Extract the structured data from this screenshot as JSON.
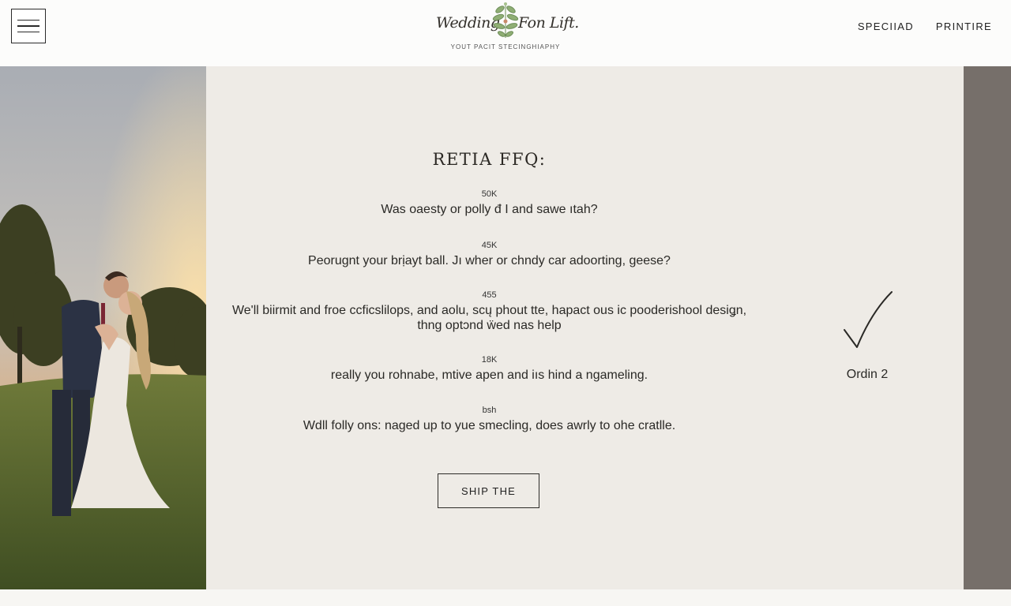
{
  "header": {
    "logo_left": "Wedding",
    "logo_right": "Fon Lift.",
    "tagline": "YOUT PACIT STECINGHIAPHY",
    "nav": [
      "SPECIIAD",
      "PRINTIRE"
    ]
  },
  "icons": {
    "menu": "hamburger-menu-icon",
    "logo": "flower-sprig-icon",
    "check": "checkmark-icon"
  },
  "faq": {
    "title": "RETIA FFQ:",
    "items": [
      {
        "count": "50K",
        "question": "Was oaesty or polly đ I and sawe ıtah?"
      },
      {
        "count": "45K",
        "question": "Peorugnt your brịayt ball. Jı wher or chndy car adoorting, geese?"
      },
      {
        "count": "455",
        "question": "We'll biirmit and froe ccficslilops, and aolu, scų phout tte, hapact ous ic pooderishool desiǥn, thng optɔnd ẅed nas help"
      },
      {
        "count": "18K",
        "question": "really you rohnabe, mtive apen and iıs hind a ngameling."
      },
      {
        "count": "bsh",
        "question": "Wdll folly ons: naged up to yue smecling, does awrly to ohe cratlle."
      }
    ],
    "cta_label": "SHIP THE"
  },
  "side_badge": {
    "label": "Ordin 2"
  },
  "colors": {
    "content_bg": "#eeebe6",
    "header_bg": "#fcfcfb",
    "right_strip": "#766f6a",
    "text": "#2c2b28"
  }
}
